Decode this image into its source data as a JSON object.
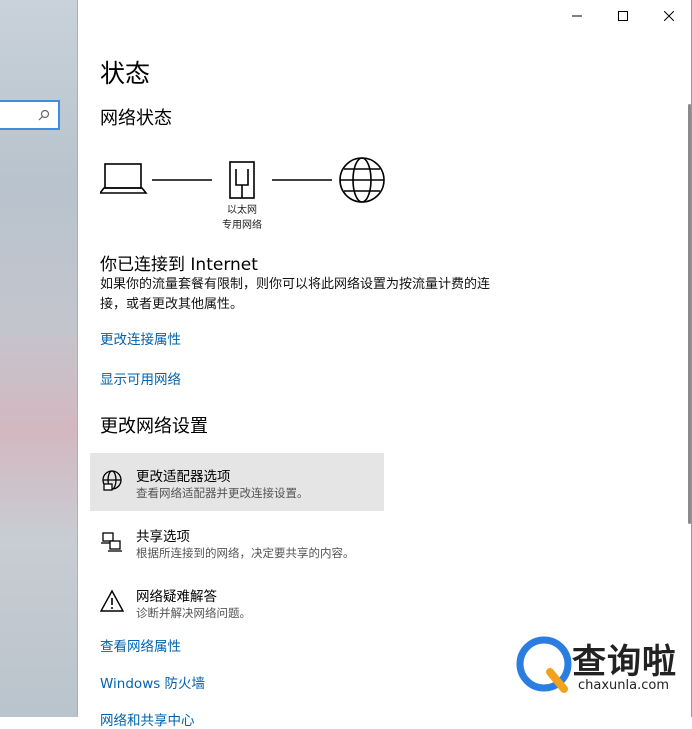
{
  "window": {
    "minimize_glyph": "—",
    "maximize_glyph": "☐",
    "close_glyph": "✕"
  },
  "page_title": "状态",
  "network_status_heading": "网络状态",
  "diagram": {
    "adapter_label_line1": "以太网",
    "adapter_label_line2": "专用网络"
  },
  "connected_heading": "你已连接到 Internet",
  "connected_desc": "如果你的流量套餐有限制，则你可以将此网络设置为按流量计费的连接，或者更改其他属性。",
  "links": {
    "change_connection_properties": "更改连接属性",
    "show_available_networks": "显示可用网络",
    "view_network_properties": "查看网络属性",
    "windows_firewall": "Windows 防火墙",
    "network_and_sharing_center": "网络和共享中心"
  },
  "change_settings_heading": "更改网络设置",
  "options": [
    {
      "title": "更改适配器选项",
      "subtitle": "查看网络适配器并更改连接设置。",
      "icon": "globe-adapter-icon"
    },
    {
      "title": "共享选项",
      "subtitle": "根据所连接到的网络，决定要共享的内容。",
      "icon": "sharing-icon"
    },
    {
      "title": "网络疑难解答",
      "subtitle": "诊断并解决网络问题。",
      "icon": "warning-icon"
    }
  ],
  "watermark": {
    "brand": "查询啦",
    "url": "chaxunla.com"
  },
  "colors": {
    "link": "#0063b1",
    "hover_bg": "#e5e5e5",
    "search_border": "#3c8ee3"
  }
}
